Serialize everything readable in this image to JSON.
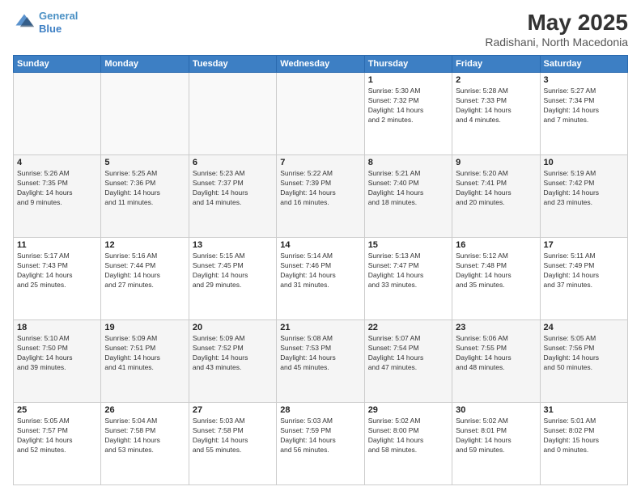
{
  "header": {
    "logo_line1": "General",
    "logo_line2": "Blue",
    "month_title": "May 2025",
    "location": "Radishani, North Macedonia"
  },
  "weekdays": [
    "Sunday",
    "Monday",
    "Tuesday",
    "Wednesday",
    "Thursday",
    "Friday",
    "Saturday"
  ],
  "weeks": [
    [
      {
        "day": "",
        "info": ""
      },
      {
        "day": "",
        "info": ""
      },
      {
        "day": "",
        "info": ""
      },
      {
        "day": "",
        "info": ""
      },
      {
        "day": "1",
        "info": "Sunrise: 5:30 AM\nSunset: 7:32 PM\nDaylight: 14 hours\nand 2 minutes."
      },
      {
        "day": "2",
        "info": "Sunrise: 5:28 AM\nSunset: 7:33 PM\nDaylight: 14 hours\nand 4 minutes."
      },
      {
        "day": "3",
        "info": "Sunrise: 5:27 AM\nSunset: 7:34 PM\nDaylight: 14 hours\nand 7 minutes."
      }
    ],
    [
      {
        "day": "4",
        "info": "Sunrise: 5:26 AM\nSunset: 7:35 PM\nDaylight: 14 hours\nand 9 minutes."
      },
      {
        "day": "5",
        "info": "Sunrise: 5:25 AM\nSunset: 7:36 PM\nDaylight: 14 hours\nand 11 minutes."
      },
      {
        "day": "6",
        "info": "Sunrise: 5:23 AM\nSunset: 7:37 PM\nDaylight: 14 hours\nand 14 minutes."
      },
      {
        "day": "7",
        "info": "Sunrise: 5:22 AM\nSunset: 7:39 PM\nDaylight: 14 hours\nand 16 minutes."
      },
      {
        "day": "8",
        "info": "Sunrise: 5:21 AM\nSunset: 7:40 PM\nDaylight: 14 hours\nand 18 minutes."
      },
      {
        "day": "9",
        "info": "Sunrise: 5:20 AM\nSunset: 7:41 PM\nDaylight: 14 hours\nand 20 minutes."
      },
      {
        "day": "10",
        "info": "Sunrise: 5:19 AM\nSunset: 7:42 PM\nDaylight: 14 hours\nand 23 minutes."
      }
    ],
    [
      {
        "day": "11",
        "info": "Sunrise: 5:17 AM\nSunset: 7:43 PM\nDaylight: 14 hours\nand 25 minutes."
      },
      {
        "day": "12",
        "info": "Sunrise: 5:16 AM\nSunset: 7:44 PM\nDaylight: 14 hours\nand 27 minutes."
      },
      {
        "day": "13",
        "info": "Sunrise: 5:15 AM\nSunset: 7:45 PM\nDaylight: 14 hours\nand 29 minutes."
      },
      {
        "day": "14",
        "info": "Sunrise: 5:14 AM\nSunset: 7:46 PM\nDaylight: 14 hours\nand 31 minutes."
      },
      {
        "day": "15",
        "info": "Sunrise: 5:13 AM\nSunset: 7:47 PM\nDaylight: 14 hours\nand 33 minutes."
      },
      {
        "day": "16",
        "info": "Sunrise: 5:12 AM\nSunset: 7:48 PM\nDaylight: 14 hours\nand 35 minutes."
      },
      {
        "day": "17",
        "info": "Sunrise: 5:11 AM\nSunset: 7:49 PM\nDaylight: 14 hours\nand 37 minutes."
      }
    ],
    [
      {
        "day": "18",
        "info": "Sunrise: 5:10 AM\nSunset: 7:50 PM\nDaylight: 14 hours\nand 39 minutes."
      },
      {
        "day": "19",
        "info": "Sunrise: 5:09 AM\nSunset: 7:51 PM\nDaylight: 14 hours\nand 41 minutes."
      },
      {
        "day": "20",
        "info": "Sunrise: 5:09 AM\nSunset: 7:52 PM\nDaylight: 14 hours\nand 43 minutes."
      },
      {
        "day": "21",
        "info": "Sunrise: 5:08 AM\nSunset: 7:53 PM\nDaylight: 14 hours\nand 45 minutes."
      },
      {
        "day": "22",
        "info": "Sunrise: 5:07 AM\nSunset: 7:54 PM\nDaylight: 14 hours\nand 47 minutes."
      },
      {
        "day": "23",
        "info": "Sunrise: 5:06 AM\nSunset: 7:55 PM\nDaylight: 14 hours\nand 48 minutes."
      },
      {
        "day": "24",
        "info": "Sunrise: 5:05 AM\nSunset: 7:56 PM\nDaylight: 14 hours\nand 50 minutes."
      }
    ],
    [
      {
        "day": "25",
        "info": "Sunrise: 5:05 AM\nSunset: 7:57 PM\nDaylight: 14 hours\nand 52 minutes."
      },
      {
        "day": "26",
        "info": "Sunrise: 5:04 AM\nSunset: 7:58 PM\nDaylight: 14 hours\nand 53 minutes."
      },
      {
        "day": "27",
        "info": "Sunrise: 5:03 AM\nSunset: 7:58 PM\nDaylight: 14 hours\nand 55 minutes."
      },
      {
        "day": "28",
        "info": "Sunrise: 5:03 AM\nSunset: 7:59 PM\nDaylight: 14 hours\nand 56 minutes."
      },
      {
        "day": "29",
        "info": "Sunrise: 5:02 AM\nSunset: 8:00 PM\nDaylight: 14 hours\nand 58 minutes."
      },
      {
        "day": "30",
        "info": "Sunrise: 5:02 AM\nSunset: 8:01 PM\nDaylight: 14 hours\nand 59 minutes."
      },
      {
        "day": "31",
        "info": "Sunrise: 5:01 AM\nSunset: 8:02 PM\nDaylight: 15 hours\nand 0 minutes."
      }
    ]
  ]
}
